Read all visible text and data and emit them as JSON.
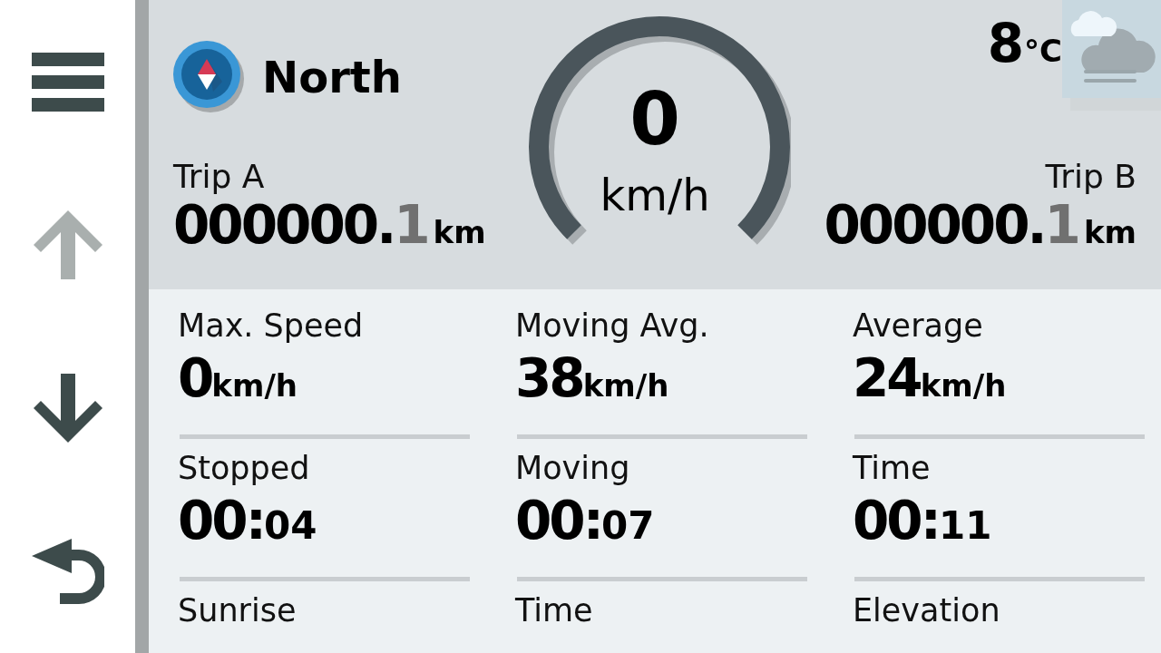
{
  "sidebar": {
    "buttons": [
      {
        "kind": "menu",
        "disabled": false
      },
      {
        "kind": "up",
        "disabled": true
      },
      {
        "kind": "down",
        "disabled": false
      },
      {
        "kind": "back",
        "disabled": false
      }
    ]
  },
  "heading": {
    "direction": "North"
  },
  "speed": {
    "value": "0",
    "unit": "km/h"
  },
  "weather": {
    "temperature": "8",
    "unit": "°C"
  },
  "trips": [
    {
      "label": "Trip A",
      "value": "000000.",
      "decimal": "1",
      "unit": "km"
    },
    {
      "label": "Trip B",
      "value": "000000.",
      "decimal": "1",
      "unit": "km"
    }
  ],
  "stats": [
    {
      "label": "Max. Speed",
      "value": "0",
      "suffix": "km/h"
    },
    {
      "label": "Moving Avg.",
      "value": "38",
      "suffix": "km/h"
    },
    {
      "label": "Average",
      "value": "24",
      "suffix": "km/h"
    },
    {
      "label": "Stopped",
      "value": "00:",
      "suffix": "04"
    },
    {
      "label": "Moving",
      "value": "00:",
      "suffix": "07"
    },
    {
      "label": "Time",
      "value": "00:",
      "suffix": "11"
    },
    {
      "label": "Sunrise"
    },
    {
      "label": "Time"
    },
    {
      "label": "Elevation"
    }
  ]
}
